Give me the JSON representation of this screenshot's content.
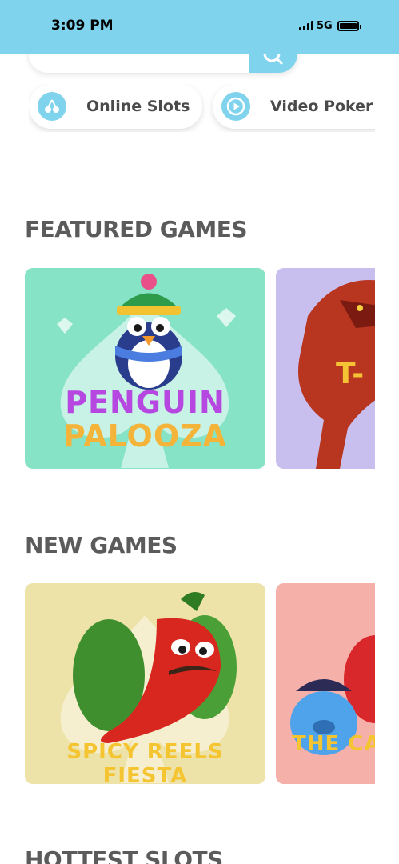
{
  "status_bar": {
    "time": "3:09 PM",
    "network": "5G"
  },
  "search": {
    "placeholder": "Search"
  },
  "categories": [
    {
      "label": "Online Slots",
      "icon": "cherries-icon"
    },
    {
      "label": "Video Poker",
      "icon": "play-icon"
    }
  ],
  "sections": {
    "featured": {
      "title": "FEATURED GAMES",
      "games": [
        {
          "line1": "PENGUIN",
          "line2": "PALOOZA",
          "bg": "#86e3c5"
        },
        {
          "line1": "T-",
          "bg": "#c9bfef"
        }
      ]
    },
    "new": {
      "title": "NEW GAMES",
      "games": [
        {
          "text": "SPICY REELS FIESTA",
          "bg": "#ede2a8"
        },
        {
          "text": "THE CA",
          "bg": "#f6b0aa"
        }
      ]
    },
    "hottest": {
      "title": "HOTTEST SLOTS"
    }
  },
  "colors": {
    "accent": "#7fd3ec",
    "title": "#5b5b5b"
  }
}
